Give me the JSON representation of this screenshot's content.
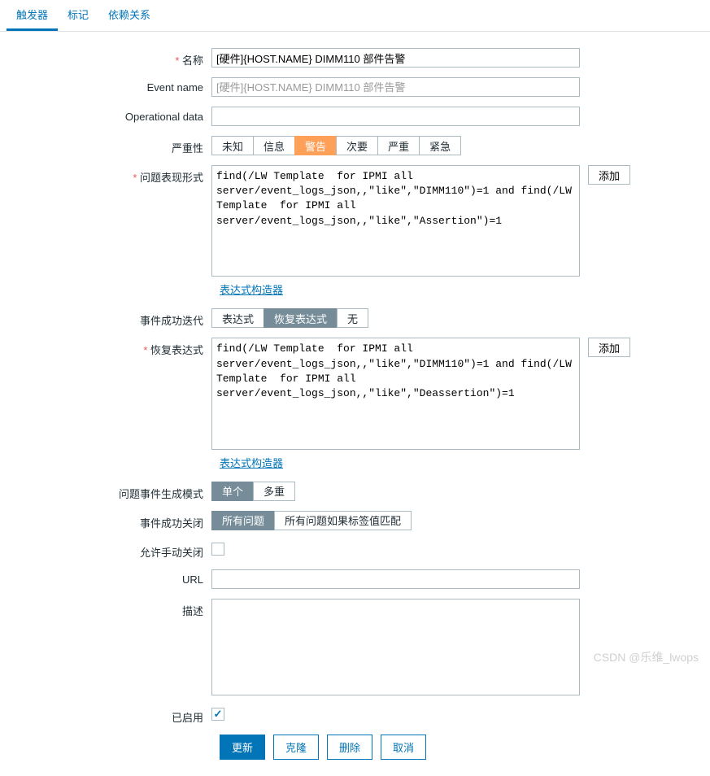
{
  "tabs": {
    "trigger": "触发器",
    "tag": "标记",
    "deps": "依赖关系"
  },
  "labels": {
    "name": "名称",
    "event_name": "Event name",
    "op_data": "Operational data",
    "severity": "严重性",
    "problem_expr": "问题表现形式",
    "ok_iteration": "事件成功迭代",
    "recovery_expr": "恢复表达式",
    "problem_mode": "问题事件生成模式",
    "ok_close": "事件成功关闭",
    "manual_close": "允许手动关闭",
    "url": "URL",
    "desc": "描述",
    "enabled": "已启用"
  },
  "fields": {
    "name_value": "[硬件]{HOST.NAME} DIMM110 部件告警",
    "event_name_placeholder": "[硬件]{HOST.NAME} DIMM110 部件告警",
    "problem_expr_value": "find(/LW Template  for IPMI all server/event_logs_json,,\"like\",\"DIMM110\")=1 and find(/LW Template  for IPMI all server/event_logs_json,,\"like\",\"Assertion\")=1",
    "recovery_expr_value": "find(/LW Template  for IPMI all server/event_logs_json,,\"like\",\"DIMM110\")=1 and find(/LW Template  for IPMI all server/event_logs_json,,\"like\",\"Deassertion\")=1"
  },
  "severity": {
    "unknown": "未知",
    "info": "信息",
    "warn": "警告",
    "minor": "次要",
    "major": "严重",
    "critical": "紧急"
  },
  "ok_iteration": {
    "expression": "表达式",
    "recovery": "恢复表达式",
    "none": "无"
  },
  "problem_mode": {
    "single": "单个",
    "multiple": "多重"
  },
  "ok_close": {
    "all": "所有问题",
    "match": "所有问题如果标签值匹配"
  },
  "buttons": {
    "add": "添加",
    "expr_builder": "表达式构造器",
    "update": "更新",
    "clone": "克隆",
    "delete": "删除",
    "cancel": "取消"
  },
  "watermark": "CSDN @乐维_lwops"
}
